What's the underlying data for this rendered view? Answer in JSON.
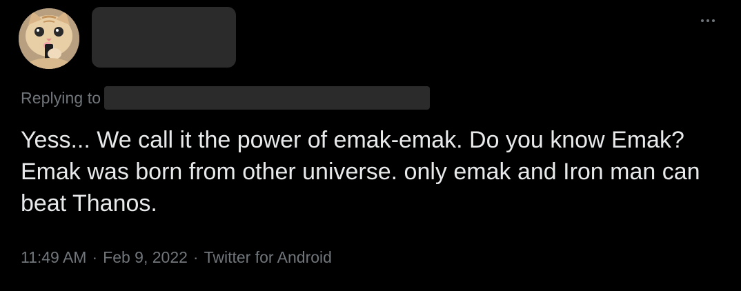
{
  "tweet": {
    "replying_to_label": "Replying to",
    "text": "Yess... We call it the power of emak-emak. Do you know Emak? Emak was born from other universe. only emak and Iron man can beat Thanos.",
    "time": "11:49 AM",
    "separator": "·",
    "date": "Feb 9, 2022",
    "source": "Twitter for Android"
  },
  "icons": {
    "more": "more-horizontal-icon",
    "avatar": "cat-avatar-image"
  },
  "colors": {
    "background": "#000000",
    "text_primary": "#e7e9ea",
    "text_secondary": "#71767b",
    "redaction": "#2b2b2b"
  }
}
